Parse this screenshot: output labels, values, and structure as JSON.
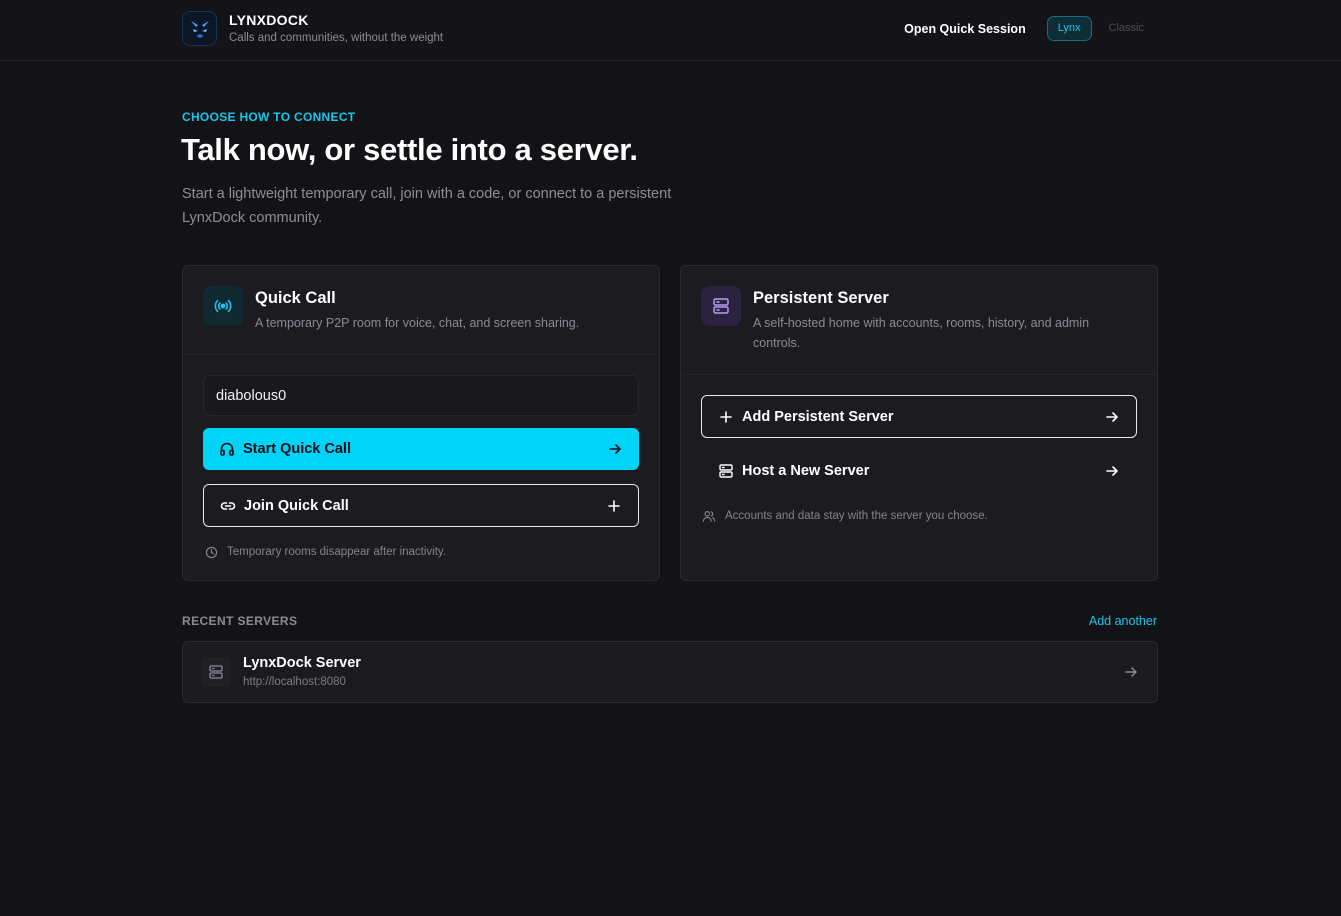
{
  "header": {
    "brand_title": "LYNXDOCK",
    "brand_subtitle": "Calls and communities, without the weight",
    "open_quick_session": "Open Quick Session",
    "theme_options": [
      "Lynx",
      "Classic"
    ],
    "active_theme": "Lynx"
  },
  "hero": {
    "eyebrow": "CHOOSE HOW TO CONNECT",
    "title": "Talk now, or settle into a server.",
    "subtitle": "Start a lightweight temporary call, join with a code, or connect to a persistent LynxDock community."
  },
  "quick_call": {
    "icon": "broadcast-icon",
    "title": "Quick Call",
    "description": "A temporary P2P room for voice, chat, and screen sharing.",
    "name_value": "diabolous0",
    "start_label": "Start Quick Call",
    "join_label": "Join Quick Call",
    "note": "Temporary rooms disappear after inactivity."
  },
  "persistent_server": {
    "icon": "server-icon",
    "title": "Persistent Server",
    "description": "A self-hosted home with accounts, rooms, history, and admin controls.",
    "add_label": "Add Persistent Server",
    "host_label": "Host a New Server",
    "note": "Accounts and data stay with the server you choose."
  },
  "recent": {
    "label": "RECENT SERVERS",
    "add_another": "Add another",
    "servers": [
      {
        "name": "LynxDock Server",
        "url": "http://localhost:8080"
      }
    ]
  },
  "colors": {
    "accent": "#00d4f6",
    "background": "#131317",
    "card": "#1b1b20",
    "purple_accent": "#2b2240"
  }
}
